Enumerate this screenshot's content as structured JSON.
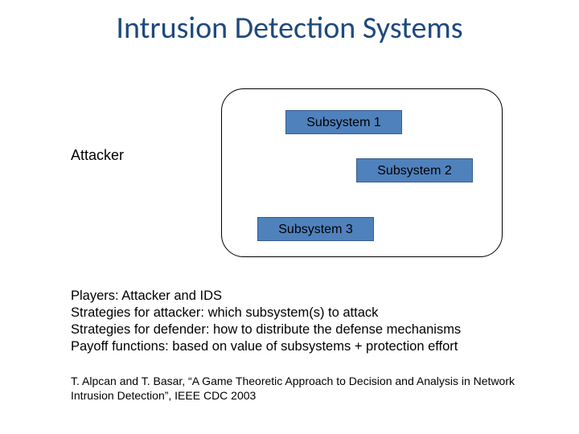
{
  "title": "Intrusion Detection Systems",
  "diagram": {
    "attacker_label": "Attacker",
    "subsystems": {
      "s1": "Subsystem 1",
      "s2": "Subsystem 2",
      "s3": "Subsystem 3"
    }
  },
  "body": {
    "line1": "Players: Attacker and IDS",
    "line2": "Strategies for attacker: which subsystem(s) to attack",
    "line3": "Strategies for defender: how to distribute the defense mechanisms",
    "line4": "Payoff functions: based on value of subsystems + protection effort"
  },
  "citation": "T. Alpcan and T. Basar, “A Game Theoretic Approach to Decision and Analysis in Network Intrusion Detection”, IEEE CDC 2003"
}
